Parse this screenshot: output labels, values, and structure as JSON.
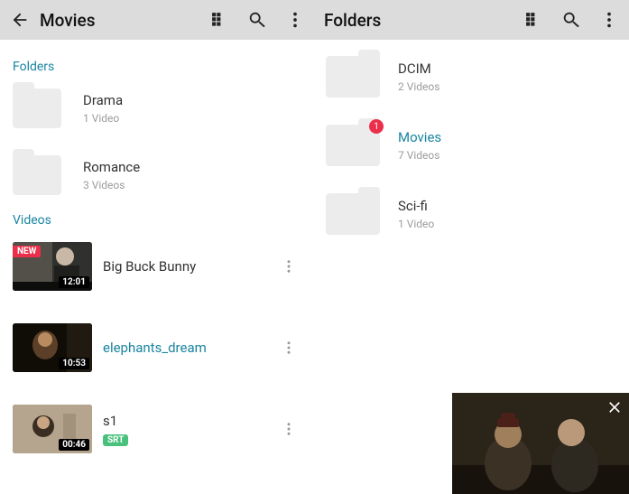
{
  "left": {
    "topbar": {
      "title": "Movies"
    },
    "sections": {
      "folders_label": "Folders",
      "videos_label": "Videos"
    },
    "folders": [
      {
        "name": "Drama",
        "sub": "1 Video"
      },
      {
        "name": "Romance",
        "sub": "3 Videos"
      }
    ],
    "videos": [
      {
        "title": "Big Buck Bunny",
        "duration": "12:01",
        "new": "NEW",
        "accent": false,
        "srt": false
      },
      {
        "title": "elephants_dream",
        "duration": "10:53",
        "new": null,
        "accent": true,
        "srt": false
      },
      {
        "title": "s1",
        "duration": "00:46",
        "new": null,
        "accent": false,
        "srt": "SRT"
      }
    ]
  },
  "right": {
    "topbar": {
      "title": "Folders"
    },
    "folders": [
      {
        "name": "DCIM",
        "sub": "2 Videos",
        "badge": null,
        "accent": false
      },
      {
        "name": "Movies",
        "sub": "7 Videos",
        "badge": "1",
        "accent": true
      },
      {
        "name": "Sci-fi",
        "sub": "1 Video",
        "badge": null,
        "accent": false
      }
    ]
  }
}
